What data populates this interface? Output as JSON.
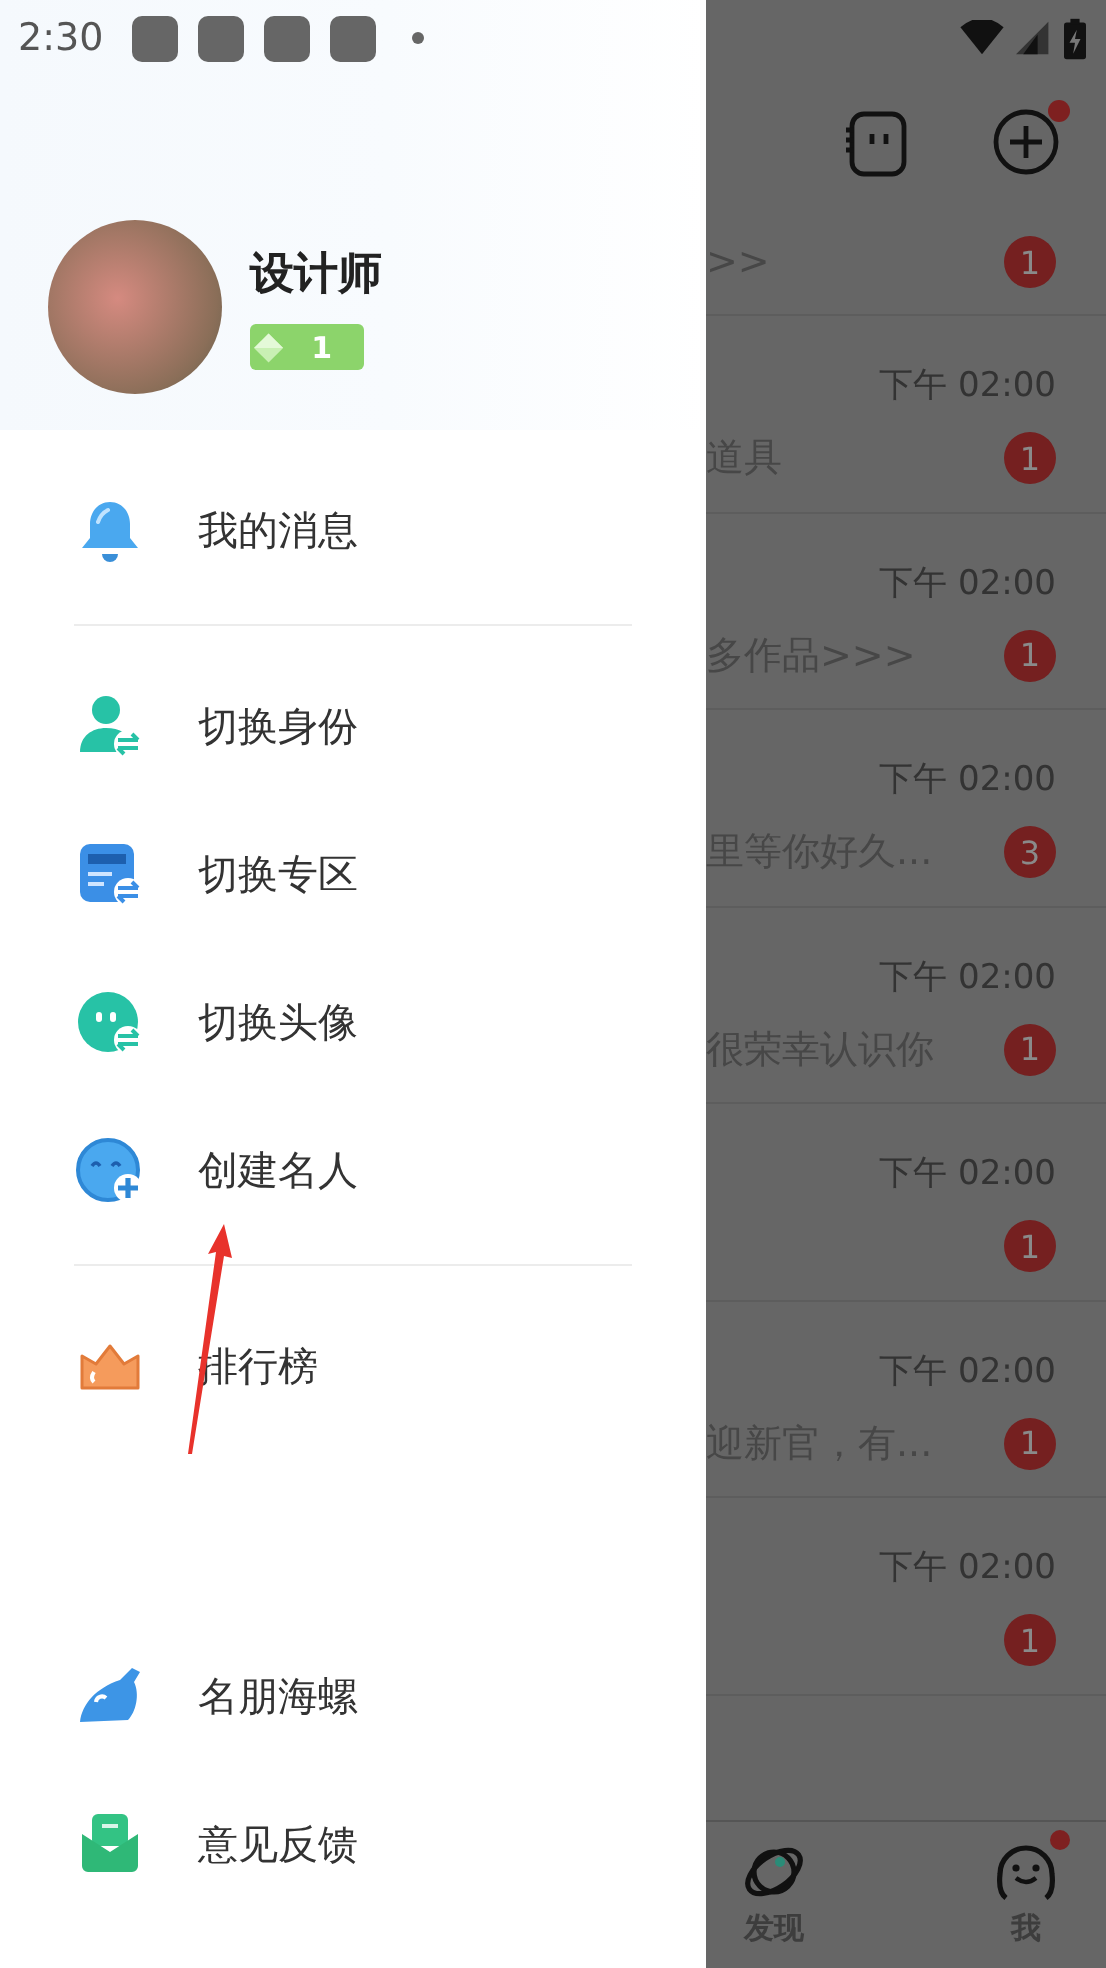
{
  "status_bar": {
    "time": "2:30"
  },
  "drawer": {
    "user": {
      "name": "设计师",
      "level": "1"
    },
    "groups": [
      {
        "items": [
          {
            "label": "我的消息"
          }
        ]
      },
      {
        "items": [
          {
            "label": "切换身份"
          },
          {
            "label": "切换专区"
          },
          {
            "label": "切换头像"
          },
          {
            "label": "创建名人"
          }
        ]
      },
      {
        "items": [
          {
            "label": "排行榜"
          }
        ]
      }
    ],
    "footer_items": [
      {
        "label": "名朋海螺"
      },
      {
        "label": "意见反馈"
      }
    ]
  },
  "background_app": {
    "header": {
      "plus_notification": true
    },
    "chats": [
      {
        "preview": ">>",
        "badge": "1"
      },
      {
        "time": "下午 02:00",
        "preview": "道具",
        "badge": "1"
      },
      {
        "time": "下午 02:00",
        "preview": "多作品>>>",
        "badge": "1"
      },
      {
        "time": "下午 02:00",
        "preview": "里等你好久...",
        "badge": "3"
      },
      {
        "time": "下午 02:00",
        "preview": "很荣幸认识你",
        "badge": "1"
      },
      {
        "time": "下午 02:00",
        "badge": "1"
      },
      {
        "time": "下午 02:00",
        "preview": "迎新官，有...",
        "badge": "1"
      },
      {
        "time": "下午 02:00",
        "badge": "1"
      }
    ],
    "nav": [
      {
        "label": "发现",
        "notification": false
      },
      {
        "label": "我",
        "notification": true
      }
    ]
  }
}
